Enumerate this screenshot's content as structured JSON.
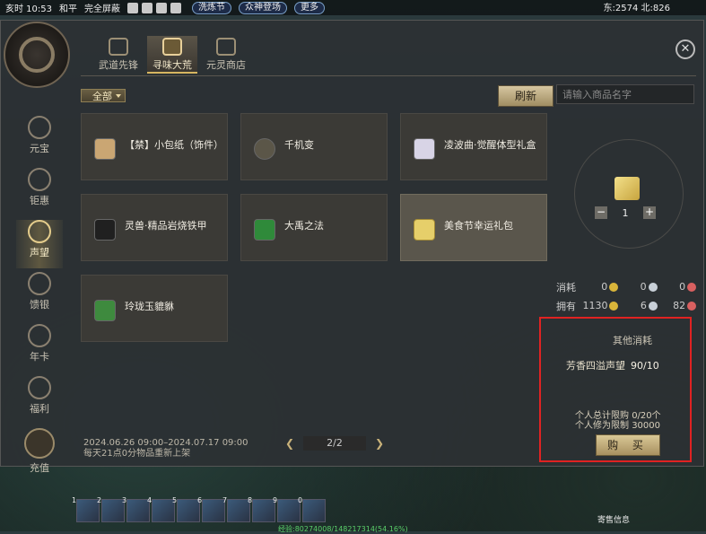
{
  "topbar": {
    "time": "亥时 10:53",
    "mode": "和平",
    "screen": "完全屏蔽",
    "event1": "洗炼节",
    "event2": "众神登场",
    "more": "更多",
    "coords": "东:2574 北:826"
  },
  "tabs": [
    {
      "label": "武道先锋"
    },
    {
      "label": "寻味大荒"
    },
    {
      "label": "元灵商店"
    }
  ],
  "sidebar": [
    {
      "label": "元宝"
    },
    {
      "label": "钜惠"
    },
    {
      "label": "声望"
    },
    {
      "label": "馈银"
    },
    {
      "label": "年卡"
    },
    {
      "label": "福利"
    },
    {
      "label": "充值"
    }
  ],
  "filter": {
    "label": "全部"
  },
  "refresh_label": "刷新",
  "search": {
    "placeholder": "请输入商品名字"
  },
  "items": [
    {
      "name": "【禁】小包纸（饰件）"
    },
    {
      "name": "千机变"
    },
    {
      "name": "凌波曲·觉醒体型礼盒"
    },
    {
      "name": "灵兽·精品岩烧铁甲"
    },
    {
      "name": "大禹之法"
    },
    {
      "name": "美食节幸运礼包"
    },
    {
      "name": "玲珑玉貔貅"
    }
  ],
  "quantity": "1",
  "cost": {
    "consume_label": "消耗",
    "own_label": "拥有",
    "consume": [
      "0",
      "0",
      "0"
    ],
    "own": [
      "1130",
      "6",
      "82"
    ],
    "coin_colors": [
      "#d9b53a",
      "#c8d0d8",
      "#d86060"
    ]
  },
  "other": {
    "title": "其他消耗",
    "line": "芳香四溢声望",
    "value": "90/10",
    "limit_total": "个人总计限购",
    "limit_total_value": "0/20个",
    "limit_cult": "个人修为限制",
    "limit_cult_value": "30000",
    "buy_label": "购 买"
  },
  "footer": {
    "date_range": "2024.06.26 09:00–2024.07.17 09:00",
    "restock": "每天21点0分物品重新上架",
    "page": "2/2"
  },
  "hotbar_keys": [
    "1",
    "2",
    "3",
    "4",
    "5",
    "6",
    "7",
    "8",
    "9",
    "0"
  ],
  "exp_text": "经验:80274008/148217314(54.16%)",
  "sell_label": "寄售信息"
}
